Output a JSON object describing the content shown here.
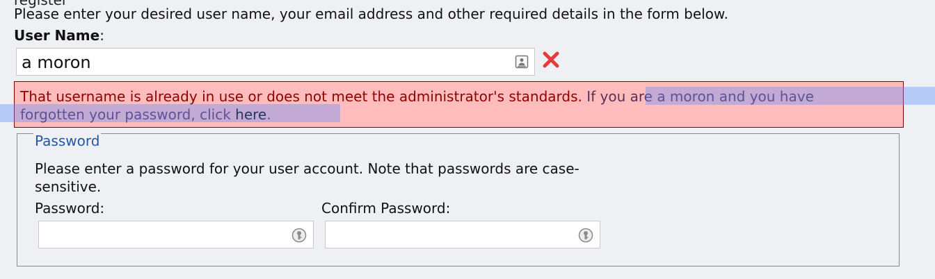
{
  "header": {
    "cut_title": "register",
    "instructions": "Please enter your desired user name, your email address and other required details in the form below."
  },
  "username": {
    "label": "User Name",
    "suffix": ":",
    "value": "a moron",
    "card_icon": "contact-card-icon",
    "clear_icon": "x-icon"
  },
  "error": {
    "message_part_1": "That username is already in use or does not meet the administrator's standards. ",
    "message_part_2": "If you are a moron and you have forgotten your password, click ",
    "link_text": "here",
    "trailing": ".",
    "colors": {
      "bg": "#ffbcbc",
      "border": "#7b0000",
      "text": "#8f0000"
    }
  },
  "password_section": {
    "legend": "Password",
    "description": "Please enter a password for your user account. Note that passwords are case-sensitive.",
    "password_label": "Password:",
    "confirm_label": "Confirm Password:",
    "password_value": "",
    "confirm_value": "",
    "key_icon": "key-icon"
  }
}
